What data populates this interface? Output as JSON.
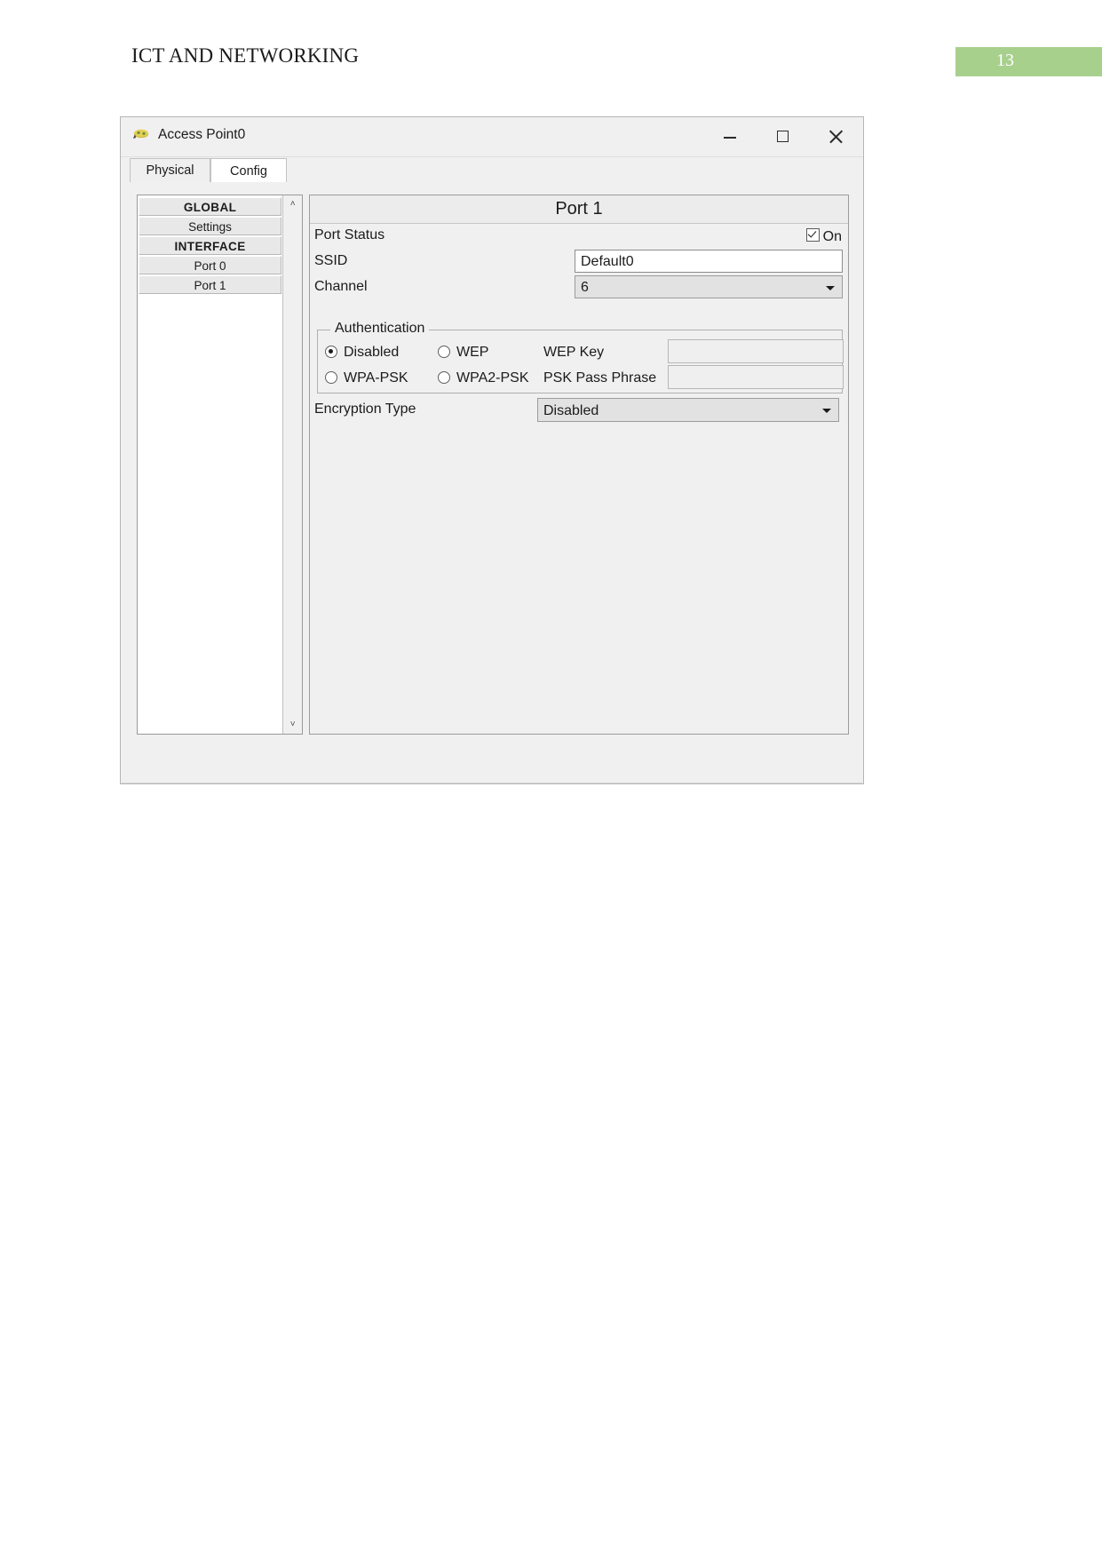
{
  "document": {
    "header_title": "ICT AND NETWORKING",
    "page_number": "13",
    "badge_color": "#a8d08d"
  },
  "window": {
    "title": "Access Point0",
    "icon": "access-point-icon",
    "controls": {
      "minimize": "minimize-icon",
      "maximize": "maximize-icon",
      "close": "close-icon"
    },
    "tabs": [
      {
        "label": "Physical",
        "active": false
      },
      {
        "label": "Config",
        "active": true
      }
    ]
  },
  "sidebar": {
    "items": [
      {
        "label": "GLOBAL",
        "type": "header"
      },
      {
        "label": "Settings",
        "type": "item"
      },
      {
        "label": "INTERFACE",
        "type": "header"
      },
      {
        "label": "Port 0",
        "type": "item"
      },
      {
        "label": "Port 1",
        "type": "item"
      }
    ],
    "scroll_up": "˄",
    "scroll_down": "˅"
  },
  "panel": {
    "title": "Port 1",
    "port_status": {
      "label": "Port Status",
      "checkbox_label": "On",
      "checked": true
    },
    "ssid": {
      "label": "SSID",
      "value": "Default0"
    },
    "channel": {
      "label": "Channel",
      "value": "6"
    },
    "authentication": {
      "legend": "Authentication",
      "options": [
        {
          "label": "Disabled",
          "selected": true
        },
        {
          "label": "WEP",
          "selected": false
        },
        {
          "label": "WPA-PSK",
          "selected": false
        },
        {
          "label": "WPA2-PSK",
          "selected": false
        }
      ],
      "wep_key": {
        "label": "WEP Key",
        "value": ""
      },
      "psk_pass_phrase": {
        "label": "PSK Pass Phrase",
        "value": ""
      }
    },
    "encryption": {
      "label": "Encryption Type",
      "value": "Disabled"
    }
  }
}
